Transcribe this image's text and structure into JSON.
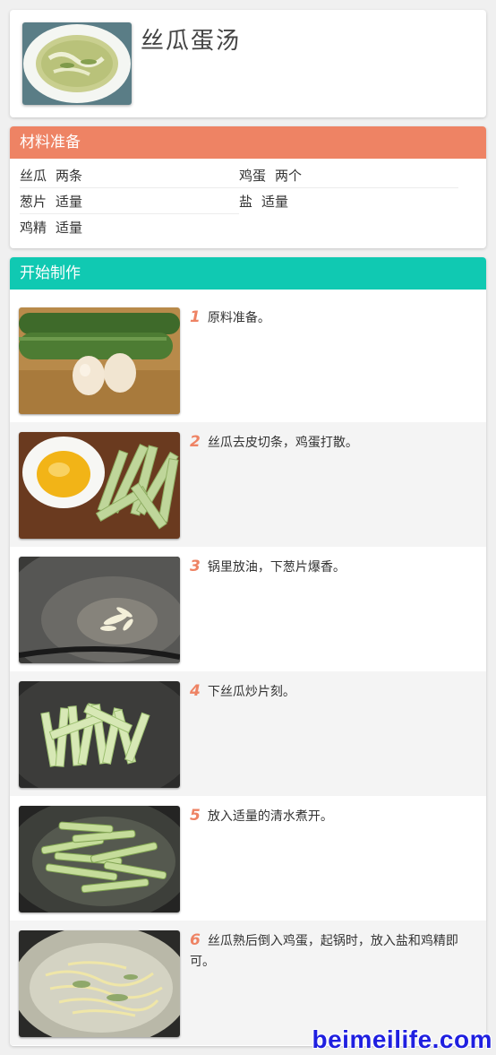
{
  "recipe": {
    "title": "丝瓜蛋汤"
  },
  "ingredients": {
    "heading": "材料准备",
    "items": [
      {
        "name": "丝瓜",
        "qty": "两条"
      },
      {
        "name": "鸡蛋",
        "qty": "两个"
      },
      {
        "name": "葱片",
        "qty": "适量"
      },
      {
        "name": "盐",
        "qty": "适量"
      },
      {
        "name": "鸡精",
        "qty": "适量"
      }
    ]
  },
  "steps": {
    "heading": "开始制作",
    "items": [
      {
        "num": "1",
        "text": "原料准备。"
      },
      {
        "num": "2",
        "text": "丝瓜去皮切条，鸡蛋打散。"
      },
      {
        "num": "3",
        "text": "锅里放油，下葱片爆香。"
      },
      {
        "num": "4",
        "text": "下丝瓜炒片刻。"
      },
      {
        "num": "5",
        "text": "放入适量的清水煮开。"
      },
      {
        "num": "6",
        "text": "丝瓜熟后倒入鸡蛋，起锅时，放入盐和鸡精即可。"
      }
    ]
  },
  "watermark": "beimeilife.com",
  "colors": {
    "ingredients_header": "#ee8364",
    "steps_header": "#10c9b2",
    "step_number": "#ee8364",
    "watermark": "#1f1fe0"
  }
}
